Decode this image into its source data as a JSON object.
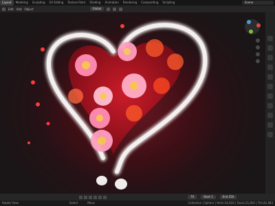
{
  "topbar": {
    "tabs": [
      "Layout",
      "Modeling",
      "Sculpting",
      "UV Editing",
      "Texture Paint",
      "Shading",
      "Animation",
      "Rendering",
      "Compositing",
      "Scripting"
    ],
    "scene": "Scene"
  },
  "header": {
    "edit": "Edit",
    "add": "Add",
    "object": "Object",
    "global": "Global"
  },
  "timeline": {
    "frame": "70",
    "start_label": "Start",
    "start": "1",
    "end_label": "End",
    "end": "250"
  },
  "status": {
    "rotate_view": "Rotate View",
    "select": "Select",
    "move": "Move",
    "info": "Collection | Sphere | Verts:24,610 | Faces:21,602 | Tris:42,483"
  },
  "colors": {
    "background": "#1d1d1d",
    "viewport_glow": "#6a1822",
    "heart_fill": "#b0101e",
    "outline": "#e8e4e4",
    "flower_pink": "#ff8fb4",
    "flower_orange": "#ff5a2a"
  }
}
